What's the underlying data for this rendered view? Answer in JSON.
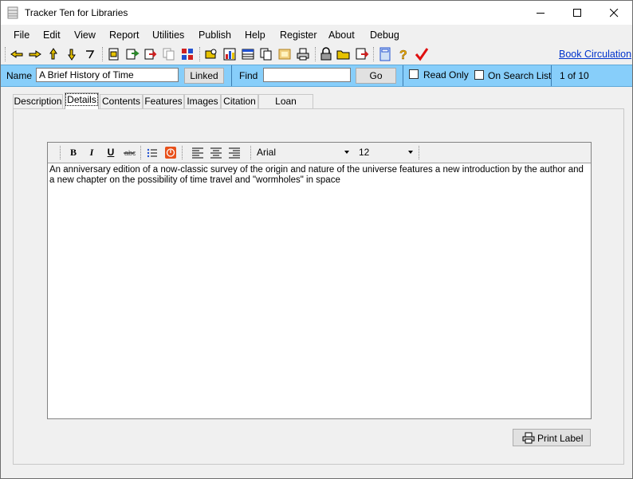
{
  "window": {
    "title": "Tracker Ten for Libraries",
    "controls": {
      "minimize": "minimize",
      "maximize": "maximize",
      "close": "close"
    }
  },
  "menu": {
    "items": [
      "File",
      "Edit",
      "View",
      "Report",
      "Utilities",
      "Publish",
      "Help",
      "Register",
      "About",
      "Debug"
    ]
  },
  "toolbar": {
    "icons": [
      "first-record-icon",
      "previous-record-icon",
      "next-record-icon",
      "last-record-icon",
      "undo-icon",
      "open-file-icon",
      "import-icon",
      "export-icon",
      "copy-icon",
      "tools-icon",
      "find-icon",
      "chart-icon",
      "table-icon",
      "copy-pages-icon",
      "image-icon",
      "print-icon",
      "lock-icon",
      "open-folder-icon",
      "save-icon",
      "calculator-icon",
      "help-icon",
      "check-icon"
    ],
    "book_circulation_link": "Book Circulation"
  },
  "namebar": {
    "name_label": "Name",
    "name_value": "A Brief History of Time",
    "linked_button": "Linked",
    "find_label": "Find",
    "find_value": "",
    "go_button": "Go",
    "read_only_label": "Read Only",
    "read_only_checked": false,
    "on_search_list_label": "On Search List",
    "on_search_list_checked": false,
    "record_position": "1 of 10"
  },
  "tabs": [
    "Description",
    "Details",
    "Contents",
    "Features",
    "Images",
    "Citation",
    "Loan History"
  ],
  "active_tab": "Details",
  "editor": {
    "font_name": "Arial",
    "font_size": "12",
    "text": "An anniversary edition of a now-classic survey of the origin and nature of the universe features a new introduction by the author and a new chapter on the possibility of time travel and \"wormholes\" in space"
  },
  "print_label_button": "Print Label",
  "colors": {
    "namebar_bg": "#87cefa",
    "link": "#0033cc",
    "check_red": "#e01010"
  }
}
